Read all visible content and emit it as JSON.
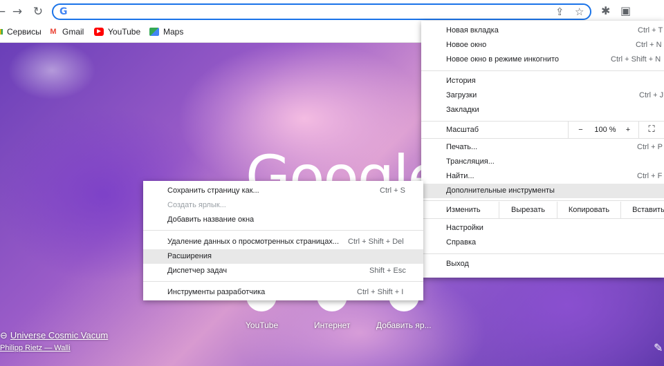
{
  "toolbar": {
    "back_icon": "arrow-left",
    "forward_icon": "→",
    "reload_icon": "↻",
    "omnibox_icon": "G",
    "share_icon": "⇪",
    "star_icon": "☆",
    "extensions_icon": "✱",
    "sidepanel_icon": "▣"
  },
  "bookmarks": [
    {
      "label": "Сервисы",
      "icon": "apps-icon"
    },
    {
      "label": "Gmail",
      "icon": "M"
    },
    {
      "label": "YouTube",
      "icon": "▶"
    },
    {
      "label": "Maps",
      "icon": "maps-icon"
    }
  ],
  "ntp": {
    "logo_text": "Google",
    "shortcuts": [
      {
        "label": "YouTube"
      },
      {
        "label": "Интернет"
      },
      {
        "label": "Добавить яр..."
      }
    ],
    "background_title": "Universe Cosmic Vacum",
    "background_author": "Philipp Rietz — Walli"
  },
  "main_menu": {
    "new_tab": {
      "label": "Новая вкладка",
      "shortcut": "Ctrl + T"
    },
    "new_window": {
      "label": "Новое окно",
      "shortcut": "Ctrl + N"
    },
    "incognito": {
      "label": "Новое окно в режиме инкогнито",
      "shortcut": "Ctrl + Shift + N"
    },
    "history": {
      "label": "История"
    },
    "downloads": {
      "label": "Загрузки",
      "shortcut": "Ctrl + J"
    },
    "bookmarks": {
      "label": "Закладки"
    },
    "zoom": {
      "label": "Масштаб",
      "minus": "−",
      "value": "100 %",
      "plus": "+"
    },
    "print": {
      "label": "Печать...",
      "shortcut": "Ctrl + P"
    },
    "cast": {
      "label": "Трансляция..."
    },
    "find": {
      "label": "Найти...",
      "shortcut": "Ctrl + F"
    },
    "more_tools": {
      "label": "Дополнительные инструменты"
    },
    "edit": {
      "label": "Изменить",
      "cut": "Вырезать",
      "copy": "Копировать",
      "paste": "Вставить"
    },
    "settings": {
      "label": "Настройки"
    },
    "help": {
      "label": "Справка"
    },
    "exit": {
      "label": "Выход"
    }
  },
  "sub_menu": {
    "save_page": {
      "label": "Сохранить страницу как...",
      "shortcut": "Ctrl + S"
    },
    "create_shortcut": {
      "label": "Создать ярлык..."
    },
    "name_window": {
      "label": "Добавить название окна"
    },
    "clear_data": {
      "label": "Удаление данных о просмотренных страницах...",
      "shortcut": "Ctrl + Shift + Del"
    },
    "extensions": {
      "label": "Расширения"
    },
    "task_manager": {
      "label": "Диспетчер задач",
      "shortcut": "Shift + Esc"
    },
    "dev_tools": {
      "label": "Инструменты разработчика",
      "shortcut": "Ctrl + Shift + I"
    }
  }
}
